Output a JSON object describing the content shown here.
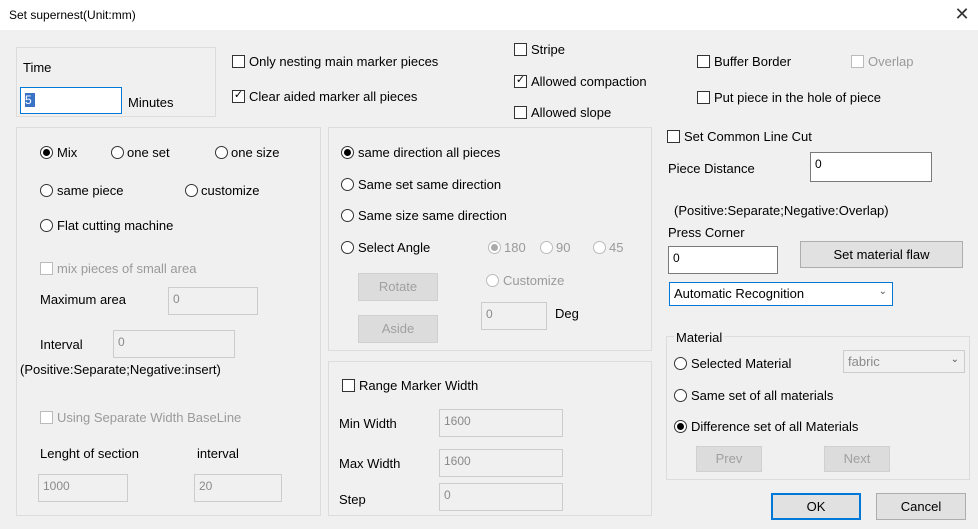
{
  "window": {
    "title": "Set supernest(Unit:mm)",
    "close_glyph": "✕"
  },
  "time": {
    "label": "Time",
    "value": "5",
    "unit": "Minutes"
  },
  "top_options": {
    "only_nesting": {
      "label": "Only nesting main marker pieces",
      "checked": false
    },
    "clear_aided": {
      "label": "Clear aided marker all pieces",
      "checked": true
    },
    "stripe": {
      "label": "Stripe",
      "checked": false
    },
    "allowed_compaction": {
      "label": "Allowed compaction",
      "checked": true
    },
    "allowed_slope": {
      "label": "Allowed slope",
      "checked": false
    },
    "buffer_border": {
      "label": "Buffer Border",
      "checked": false
    },
    "overlap": {
      "label": "Overlap",
      "checked": false
    },
    "put_in_hole": {
      "label": "Put piece in the hole of piece",
      "checked": false
    }
  },
  "nest_mode": {
    "mix": "Mix",
    "one_set": "one set",
    "one_size": "one size",
    "same_piece": "same piece",
    "customize": "customize",
    "flat_cutting": "Flat cutting machine",
    "selected": "Mix",
    "mix_small_area": "mix pieces of small area",
    "maximum_area_label": "Maximum area",
    "maximum_area_value": "0",
    "interval_label": "Interval",
    "interval_value": "0",
    "interval_note": "(Positive:Separate;Negative:insert)",
    "separate_width": "Using Separate Width BaseLine",
    "length_section_label": "Lenght of section",
    "length_section_value": "1000",
    "interval2_label": "interval",
    "interval2_value": "20"
  },
  "direction": {
    "all_pieces": "same direction all pieces",
    "same_set": "Same set same direction",
    "same_size": "Same size same direction",
    "select_angle": "Select Angle",
    "selected": "same direction all pieces",
    "angle_180": "180",
    "angle_90": "90",
    "angle_45": "45",
    "angle_customize": "Customize",
    "angle_value": "0",
    "deg": "Deg",
    "rotate": "Rotate",
    "aside": "Aside"
  },
  "range": {
    "label": "Range Marker Width",
    "min_label": "Min Width",
    "min_value": "1600",
    "max_label": "Max Width",
    "max_value": "1600",
    "step_label": "Step",
    "step_value": "0"
  },
  "right": {
    "common_line_cut": "Set Common Line Cut",
    "piece_distance_label": "Piece Distance",
    "piece_distance_value": "0",
    "note": "(Positive:Separate;Negative:Overlap)",
    "press_corner_label": "Press  Corner",
    "press_corner_value": "0",
    "set_flaw": "Set material flaw",
    "recognition": "Automatic Recognition"
  },
  "material": {
    "label": "Material",
    "selected_material": "Selected Material",
    "material_value": "fabric",
    "same_set": "Same set of all materials",
    "difference_set": "Difference set of all Materials",
    "selected": "Difference set of all Materials",
    "prev": "Prev",
    "next": "Next"
  },
  "footer": {
    "ok": "OK",
    "cancel": "Cancel"
  },
  "colors": {
    "accent": "#0078d7",
    "dialog_bg": "#f0f0f0"
  }
}
